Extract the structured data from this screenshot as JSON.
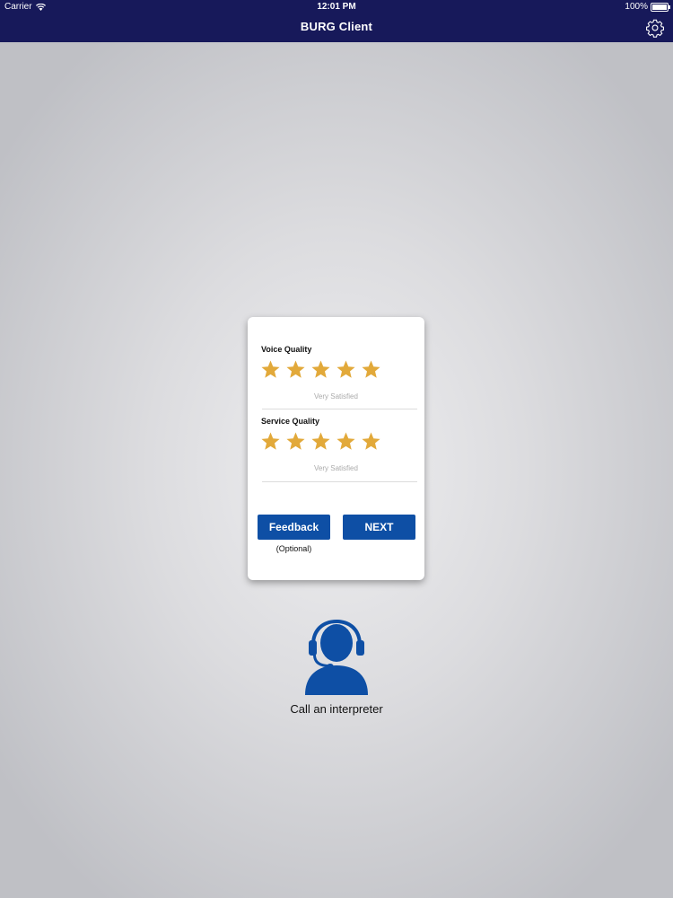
{
  "status_bar": {
    "carrier": "Carrier",
    "time": "12:01 PM",
    "battery": "100%"
  },
  "header": {
    "title": "BURG Client",
    "settings_icon": "gear-icon",
    "background_color": "#17195a"
  },
  "rating_card": {
    "voice_quality": {
      "label": "Voice Quality",
      "stars": 5,
      "max_stars": 5,
      "rating_text": "Very Satisfied"
    },
    "service_quality": {
      "label": "Service Quality",
      "stars": 5,
      "max_stars": 5,
      "rating_text": "Very Satisfied"
    },
    "feedback_button": "Feedback",
    "feedback_note": "(Optional)",
    "next_button": "NEXT",
    "star_color": "#e2a93a",
    "button_color": "#0e4fa5"
  },
  "interpreter": {
    "icon": "headset-person-icon",
    "label": "Call an interpreter",
    "icon_color": "#0e4fa5"
  }
}
